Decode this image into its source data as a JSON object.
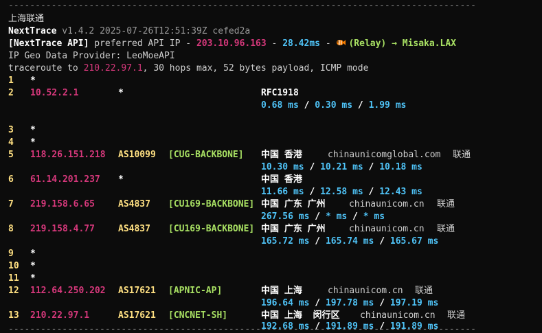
{
  "separator": "---------------------------------------------------------------------------------------",
  "header": {
    "location": "上海联通",
    "app_name": "NextTrace",
    "version_line": "v1.4.2 2025-07-26T12:51:39Z cefed2a",
    "api_label": "[NextTrace API]",
    "api_text": "preferred API IP -",
    "api_ip": "203.10.96.163",
    "dash1": "-",
    "api_latency": "28.42ms",
    "dash2": "-",
    "relay": "(Relay)",
    "arrow_target": "→ Misaka.LAX",
    "geo_provider": "IP Geo Data Provider: LeoMoeAPI",
    "traceroute_prefix": "traceroute to",
    "target_ip": "210.22.97.1",
    "traceroute_suffix": ", 30 hops max, 52 bytes payload, ICMP mode"
  },
  "hops": [
    {
      "hop": "1",
      "ip": "*"
    },
    {
      "hop": "2",
      "ip": "10.52.2.1",
      "asn": "*",
      "geo": "RFC1918",
      "rtt": [
        "0.68 ms",
        "0.30 ms",
        "1.99 ms"
      ]
    },
    {
      "hop": "3",
      "ip": "*"
    },
    {
      "hop": "4",
      "ip": "*"
    },
    {
      "hop": "5",
      "ip": "118.26.151.218",
      "asn": "AS10099",
      "tag": "[CUG-BACKBONE]",
      "geo": "中国 香港",
      "domain": "chinaunicomglobal.com",
      "isp": "联通",
      "rtt": [
        "10.30 ms",
        "10.21 ms",
        "10.18 ms"
      ]
    },
    {
      "hop": "6",
      "ip": "61.14.201.237",
      "asn": "*",
      "geo": "中国 香港",
      "rtt": [
        "11.66 ms",
        "12.58 ms",
        "12.43 ms"
      ]
    },
    {
      "hop": "7",
      "ip": "219.158.6.65",
      "asn": "AS4837",
      "tag": "[CU169-BACKBONE]",
      "geo": "中国 广东 广州",
      "domain": "chinaunicom.cn",
      "isp": "联通",
      "rtt": [
        "267.56 ms",
        "* ms",
        "* ms"
      ]
    },
    {
      "hop": "8",
      "ip": "219.158.4.77",
      "asn": "AS4837",
      "tag": "[CU169-BACKBONE]",
      "geo": "中国 广东 广州",
      "domain": "chinaunicom.cn",
      "isp": "联通",
      "rtt": [
        "165.72 ms",
        "165.74 ms",
        "165.67 ms"
      ]
    },
    {
      "hop": "9",
      "ip": "*"
    },
    {
      "hop": "10",
      "ip": "*"
    },
    {
      "hop": "11",
      "ip": "*"
    },
    {
      "hop": "12",
      "ip": "112.64.250.202",
      "asn": "AS17621",
      "tag": "[APNIC-AP]",
      "geo": "中国 上海",
      "domain": "chinaunicom.cn",
      "isp": "联通",
      "rtt": [
        "196.64 ms",
        "197.78 ms",
        "197.19 ms"
      ]
    },
    {
      "hop": "13",
      "ip": "210.22.97.1",
      "asn": "AS17621",
      "tag": "[CNCNET-SH]",
      "geo": "中国 上海  闵行区",
      "domain": "chinaunicom.cn",
      "isp": "联通",
      "rtt": [
        "192.68 ms",
        "191.89 ms",
        "191.89 ms"
      ]
    }
  ],
  "colors": {
    "background": "#0c0c0c",
    "ip": "#d6387b",
    "latency": "#4fc3f7",
    "hop_and_asn": "#ffe082",
    "tag": "#a8e063"
  },
  "icons": {
    "relay": "fish-icon"
  }
}
